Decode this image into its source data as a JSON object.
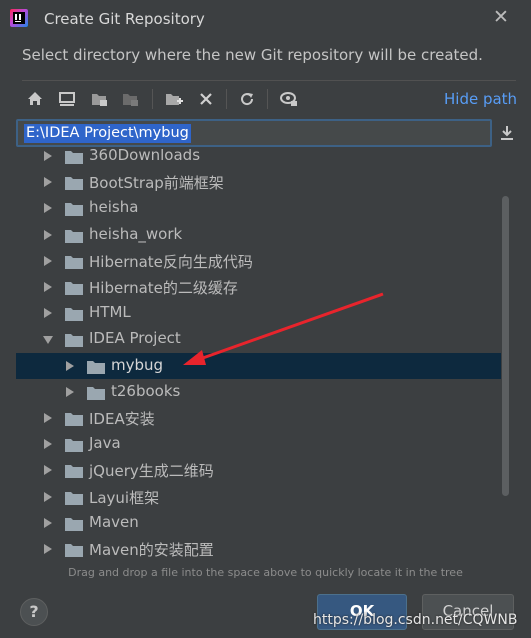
{
  "window": {
    "title": "Create Git Repository",
    "close_glyph": "✕"
  },
  "description": "Select directory where the new Git repository will be created.",
  "toolbar": {
    "icons": [
      "home-icon",
      "desktop-icon",
      "project-folder-icon",
      "module-folder-icon",
      "new-folder-icon",
      "delete-icon",
      "refresh-icon",
      "show-hidden-icon"
    ],
    "hide_path_label": "Hide path"
  },
  "path": {
    "value": "E:\\IDEA Project\\mybug"
  },
  "tree": {
    "items": [
      {
        "label": "360Downloads",
        "expanded": false,
        "selected": false,
        "level": 0
      },
      {
        "label": "BootStrap前端框架",
        "expanded": false,
        "selected": false,
        "level": 0
      },
      {
        "label": "heisha",
        "expanded": false,
        "selected": false,
        "level": 0
      },
      {
        "label": "heisha_work",
        "expanded": false,
        "selected": false,
        "level": 0
      },
      {
        "label": "Hibernate反向生成代码",
        "expanded": false,
        "selected": false,
        "level": 0
      },
      {
        "label": "Hibernate的二级缓存",
        "expanded": false,
        "selected": false,
        "level": 0
      },
      {
        "label": "HTML",
        "expanded": false,
        "selected": false,
        "level": 0
      },
      {
        "label": "IDEA Project",
        "expanded": true,
        "selected": false,
        "level": 0
      },
      {
        "label": "mybug",
        "expanded": false,
        "selected": true,
        "level": 1
      },
      {
        "label": "t26books",
        "expanded": false,
        "selected": false,
        "level": 1
      },
      {
        "label": "IDEA安装",
        "expanded": false,
        "selected": false,
        "level": 0
      },
      {
        "label": "Java",
        "expanded": false,
        "selected": false,
        "level": 0
      },
      {
        "label": "jQuery生成二维码",
        "expanded": false,
        "selected": false,
        "level": 0
      },
      {
        "label": "Layui框架",
        "expanded": false,
        "selected": false,
        "level": 0
      },
      {
        "label": "Maven",
        "expanded": false,
        "selected": false,
        "level": 0
      },
      {
        "label": "Maven的安装配置",
        "expanded": false,
        "selected": false,
        "level": 0
      }
    ]
  },
  "hint": "Drag and drop a file into the space above to quickly locate it in the tree",
  "footer": {
    "help_label": "?",
    "ok_label": "OK",
    "cancel_label": "Cancel"
  },
  "watermark": "https://blog.csdn.net/CQWNB",
  "colors": {
    "accent": "#589df6",
    "selection": "#0d293e",
    "annotation_arrow": "#e8242c"
  }
}
